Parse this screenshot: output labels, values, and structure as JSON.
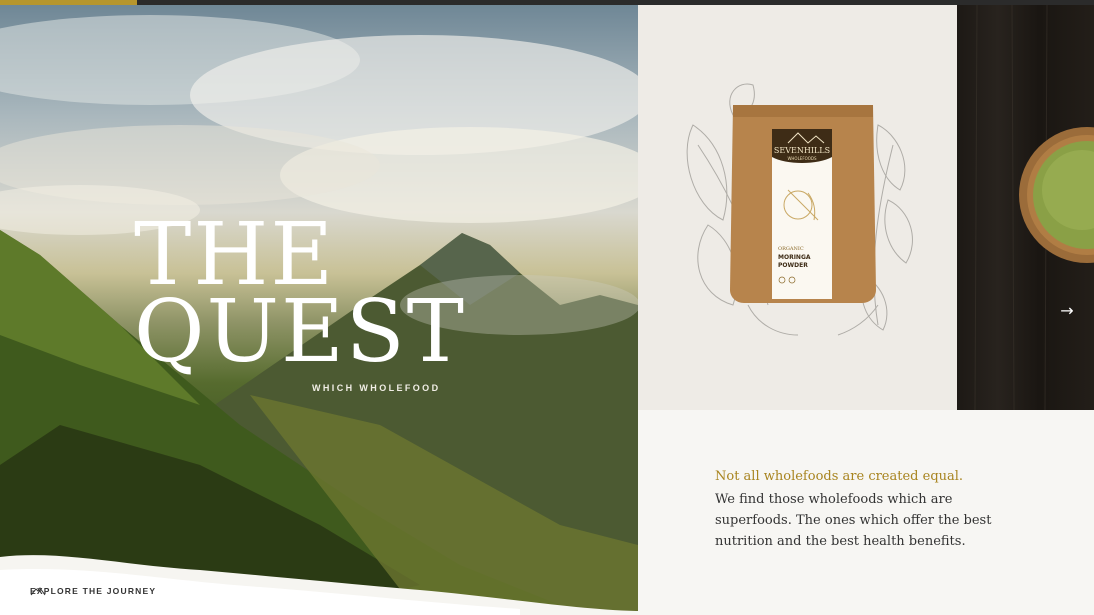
{
  "progress": {
    "value_percent": 12.5,
    "color": "#b7962d"
  },
  "hero": {
    "title_line1": "THE",
    "title_line2": "QUEST",
    "subtitle": "WHICH WHOLEFOOD",
    "explore_label": "EXPLORE THE JOURNEY"
  },
  "product": {
    "brand": "SEVENHILLS",
    "brand_sub": "WHOLEFOODS",
    "label_line1": "ORGANIC",
    "label_line2": "MORINGA",
    "label_line3": "POWDER"
  },
  "content": {
    "headline": "Not all wholefoods are created equal.",
    "body": "We find those wholefoods which are superfoods. The ones which offer the best nutrition and the best health benefits."
  },
  "icons": {
    "explore": "mountain-icon",
    "next": "arrow-right-icon"
  },
  "colors": {
    "accent": "#b7962d",
    "text": "#333333",
    "panel": "#f7f6f3"
  }
}
